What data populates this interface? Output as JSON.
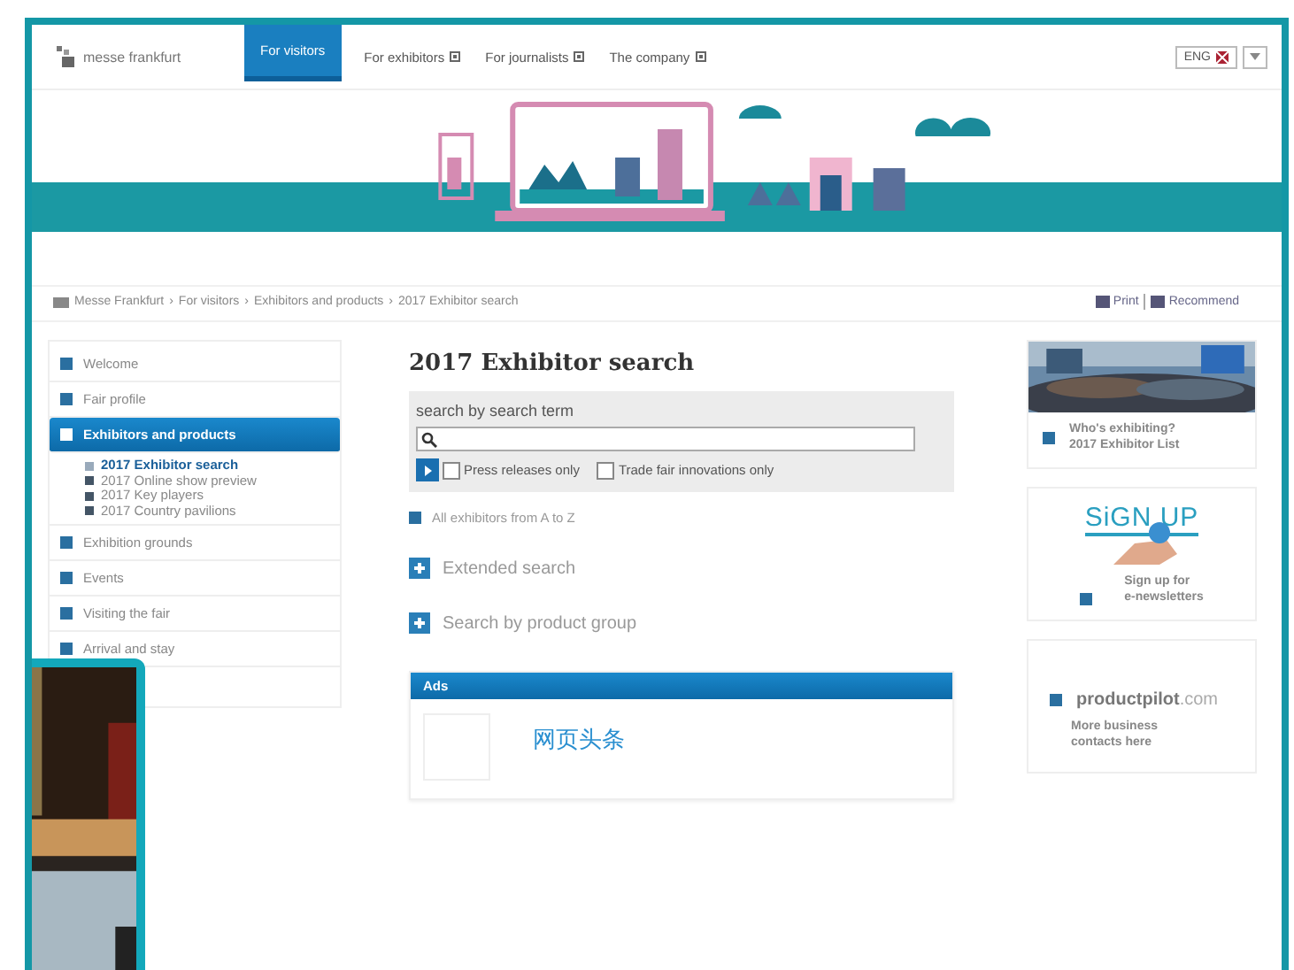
{
  "header": {
    "logo": "messe frankfurt",
    "language": "ENG"
  },
  "nav": [
    {
      "label": "For visitors",
      "selected": true,
      "dropdown": false
    },
    {
      "label": "For exhibitors",
      "selected": false,
      "dropdown": true
    },
    {
      "label": "For journalists",
      "selected": false,
      "dropdown": true
    },
    {
      "label": "The company",
      "selected": false,
      "dropdown": true
    }
  ],
  "breadcrumb": {
    "separator": "›",
    "items": [
      "Messe Frankfurt",
      "For visitors",
      "Exhibitors and products",
      "2017 Exhibitor search"
    ]
  },
  "page_tools": [
    "Print",
    "Recommend"
  ],
  "sidebar": {
    "items": [
      {
        "label": "Welcome",
        "selected": false
      },
      {
        "label": "Fair profile",
        "selected": false
      },
      {
        "label": "Exhibitors and products",
        "selected": true,
        "children": [
          {
            "label": "2017 Exhibitor search",
            "selected": true
          },
          {
            "label": "2017 Online show preview",
            "selected": false
          },
          {
            "label": "2017 Key players",
            "selected": false
          },
          {
            "label": "2017 Country pavilions",
            "selected": false
          }
        ]
      },
      {
        "label": "Exhibition grounds",
        "selected": false
      },
      {
        "label": "Events",
        "selected": false
      },
      {
        "label": "Visiting the fair",
        "selected": false
      },
      {
        "label": "Arrival and stay",
        "selected": false
      }
    ]
  },
  "main": {
    "title": "2017 Exhibitor search",
    "search": {
      "label": "search by search term",
      "filters": [
        {
          "label": "Press releases only",
          "checked": false
        },
        {
          "label": "Trade fair innovations only",
          "checked": false
        }
      ]
    },
    "az_link": "All exhibitors from A to Z",
    "expanders": [
      {
        "label": "Extended search",
        "expanded": false
      },
      {
        "label": "Search by product group",
        "expanded": false
      }
    ],
    "ads": {
      "title": "Ads",
      "items": [
        "网页头条"
      ]
    }
  },
  "teasers": [
    {
      "kind": "picture",
      "lines": [
        "Who's exhibiting?",
        "2017 Exhibitor List"
      ]
    },
    {
      "kind": "signup",
      "graphic_text": "SiGN UP",
      "lines": [
        "Sign up for",
        "e-newsletters"
      ]
    },
    {
      "kind": "brand",
      "brand": "**productpilot**.com",
      "lines": [
        "More business",
        "contacts here"
      ]
    }
  ],
  "overlay": {
    "kind": "picture"
  }
}
